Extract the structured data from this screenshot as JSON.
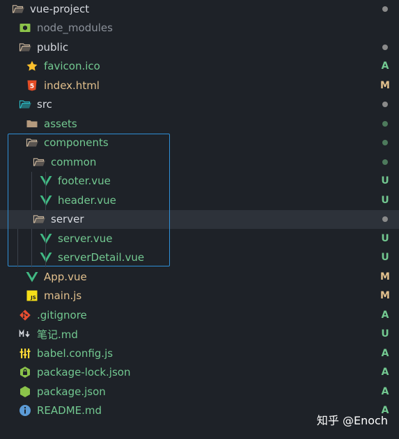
{
  "colors": {
    "background": "#1e2228",
    "selected_row": "#2d323a",
    "name_default": "#d7dae0",
    "name_added": "#73c991",
    "name_untracked": "#73c991",
    "name_modified": "#e2c08d",
    "name_ignored": "#8b919a",
    "status_dot": "#8a8a8a",
    "highlight_border": "#2f8fd6"
  },
  "explorer": {
    "items": [
      {
        "label": "vue-project",
        "icon": "folder-open-icon",
        "depth": 0,
        "state": "default",
        "status": "dot",
        "status_color": "#8a8a8a"
      },
      {
        "label": "node_modules",
        "icon": "node-modules-folder-icon",
        "depth": 1,
        "state": "ignored",
        "status": "",
        "status_color": ""
      },
      {
        "label": "public",
        "icon": "folder-open-icon",
        "depth": 1,
        "state": "default",
        "status": "dot",
        "status_color": "#8a8a8a"
      },
      {
        "label": "favicon.ico",
        "icon": "star-icon",
        "depth": 2,
        "state": "added",
        "status": "A",
        "status_color": "#73c991"
      },
      {
        "label": "index.html",
        "icon": "html5-icon",
        "depth": 2,
        "state": "modified",
        "status": "M",
        "status_color": "#e2c08d"
      },
      {
        "label": "src",
        "icon": "src-folder-icon",
        "depth": 1,
        "state": "default",
        "status": "dot",
        "status_color": "#8a8a8a"
      },
      {
        "label": "assets",
        "icon": "folder-closed-icon",
        "depth": 2,
        "state": "untracked",
        "status": "dot",
        "status_color": "#4d7a5c"
      },
      {
        "label": "components",
        "icon": "folder-open-icon",
        "depth": 2,
        "state": "untracked",
        "status": "dot",
        "status_color": "#4d7a5c"
      },
      {
        "label": "common",
        "icon": "folder-open-icon",
        "depth": 3,
        "state": "untracked",
        "status": "dot",
        "status_color": "#4d7a5c"
      },
      {
        "label": "footer.vue",
        "icon": "vue-icon",
        "depth": 4,
        "state": "untracked",
        "status": "U",
        "status_color": "#73c991"
      },
      {
        "label": "header.vue",
        "icon": "vue-icon",
        "depth": 4,
        "state": "untracked",
        "status": "U",
        "status_color": "#73c991"
      },
      {
        "label": "server",
        "icon": "folder-open-icon",
        "depth": 3,
        "state": "default",
        "status": "dot",
        "status_color": "#8a8a8a",
        "selected": true
      },
      {
        "label": "server.vue",
        "icon": "vue-icon",
        "depth": 4,
        "state": "untracked",
        "status": "U",
        "status_color": "#73c991"
      },
      {
        "label": "serverDetail.vue",
        "icon": "vue-icon",
        "depth": 4,
        "state": "untracked",
        "status": "U",
        "status_color": "#73c991"
      },
      {
        "label": "App.vue",
        "icon": "vue-icon",
        "depth": 2,
        "state": "modified",
        "status": "M",
        "status_color": "#e2c08d"
      },
      {
        "label": "main.js",
        "icon": "js-icon",
        "depth": 2,
        "state": "modified",
        "status": "M",
        "status_color": "#e2c08d"
      },
      {
        "label": ".gitignore",
        "icon": "git-icon",
        "depth": 1,
        "state": "added",
        "status": "A",
        "status_color": "#73c991"
      },
      {
        "label": "笔记.md",
        "icon": "markdown-icon",
        "depth": 1,
        "state": "untracked",
        "status": "U",
        "status_color": "#73c991"
      },
      {
        "label": "babel.config.js",
        "icon": "babel-icon",
        "depth": 1,
        "state": "added",
        "status": "A",
        "status_color": "#73c991"
      },
      {
        "label": "package-lock.json",
        "icon": "npm-lock-icon",
        "depth": 1,
        "state": "added",
        "status": "A",
        "status_color": "#73c991"
      },
      {
        "label": "package.json",
        "icon": "nodejs-icon",
        "depth": 1,
        "state": "added",
        "status": "A",
        "status_color": "#73c991"
      },
      {
        "label": "README.md",
        "icon": "info-icon",
        "depth": 1,
        "state": "added",
        "status": "A",
        "status_color": "#73c991"
      }
    ]
  },
  "watermark": "知乎 @Enoch"
}
